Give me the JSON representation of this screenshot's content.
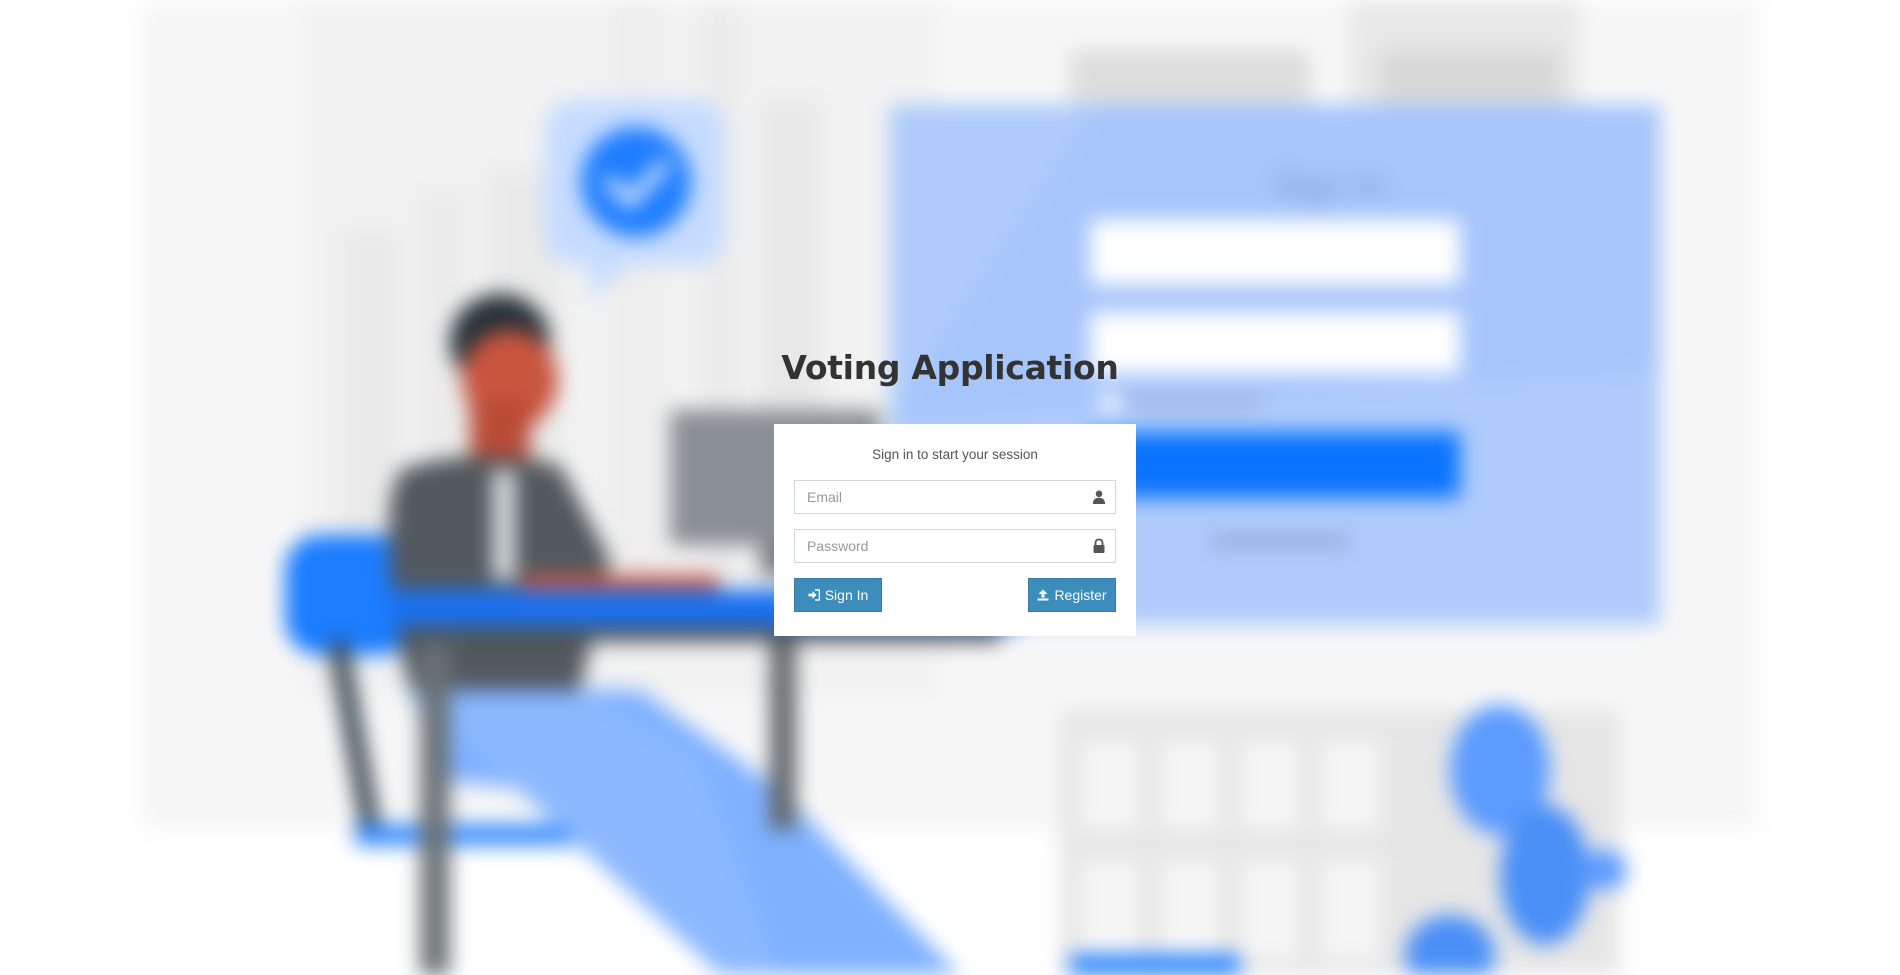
{
  "app": {
    "title": "Voting Application"
  },
  "login": {
    "message": "Sign in to start your session",
    "email_placeholder": "Email",
    "password_placeholder": "Password",
    "signin_label": "Sign In",
    "register_label": "Register"
  },
  "icons": {
    "email": "user-icon",
    "password": "lock-icon",
    "signin": "sign-in-icon",
    "register": "upload-icon"
  },
  "colors": {
    "primary": "#3c8dbc",
    "primary_border": "#367fa9",
    "accent_blue": "#2a86ff",
    "light_blue": "#9fc3ff",
    "title_text": "#333333"
  }
}
